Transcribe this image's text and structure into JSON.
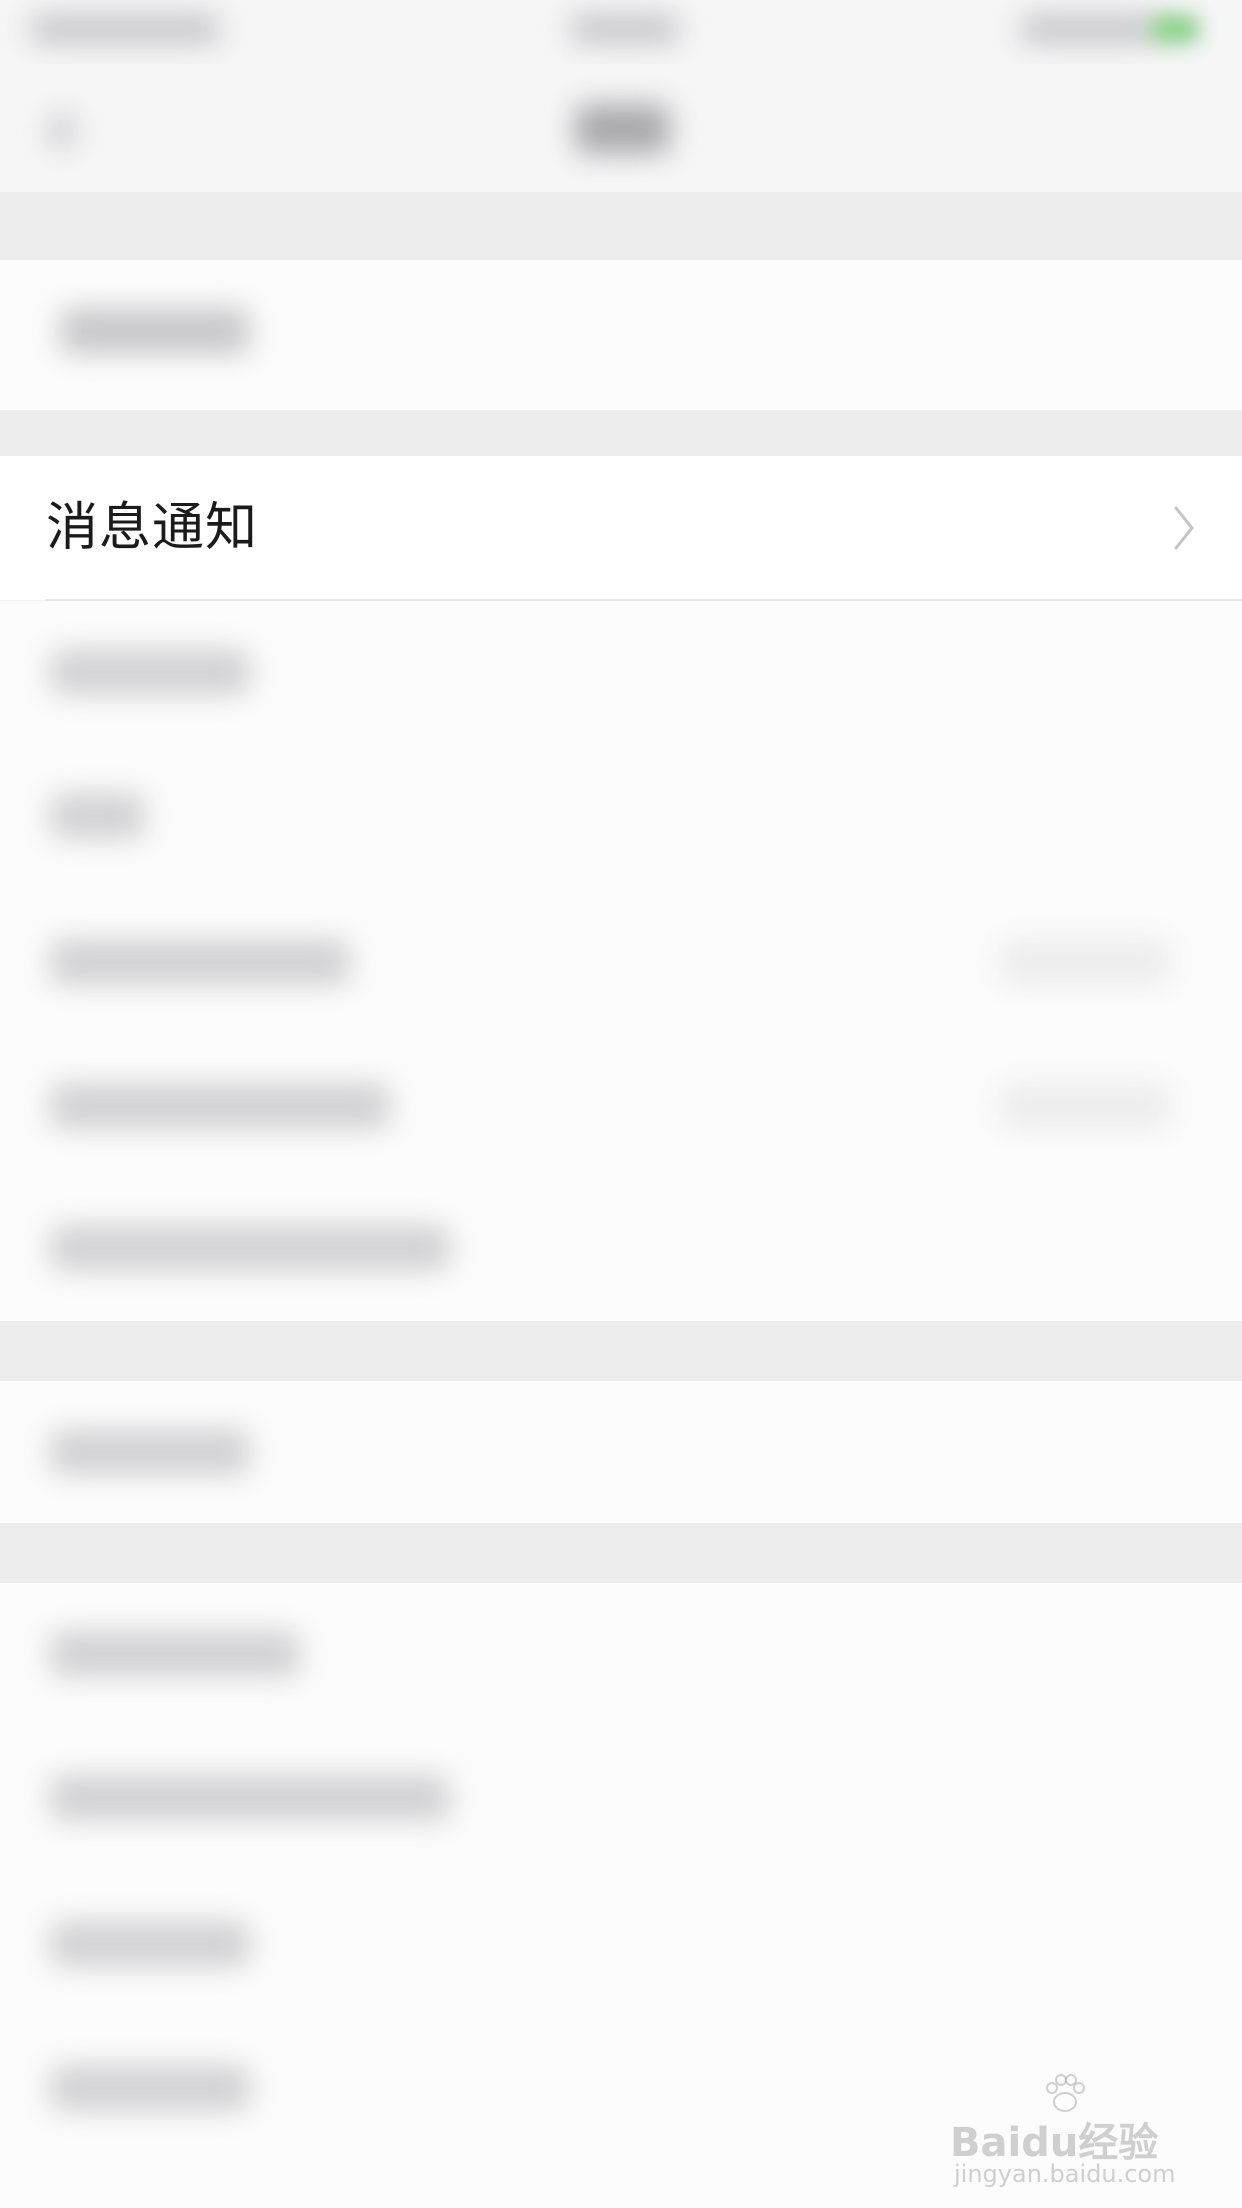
{
  "settings_item": {
    "label": "消息通知"
  },
  "watermark": {
    "brand": "Baidu经验",
    "url": "jingyan.baidu.com"
  },
  "colors": {
    "background": "#f2f2f4",
    "row_background": "#ffffff",
    "text": "#1b1b1b",
    "chevron": "#c4c4c6",
    "status_battery": "#8cd08a"
  },
  "icons": {
    "chevron": "chevron-right-icon",
    "back": "back-arrow-icon"
  }
}
